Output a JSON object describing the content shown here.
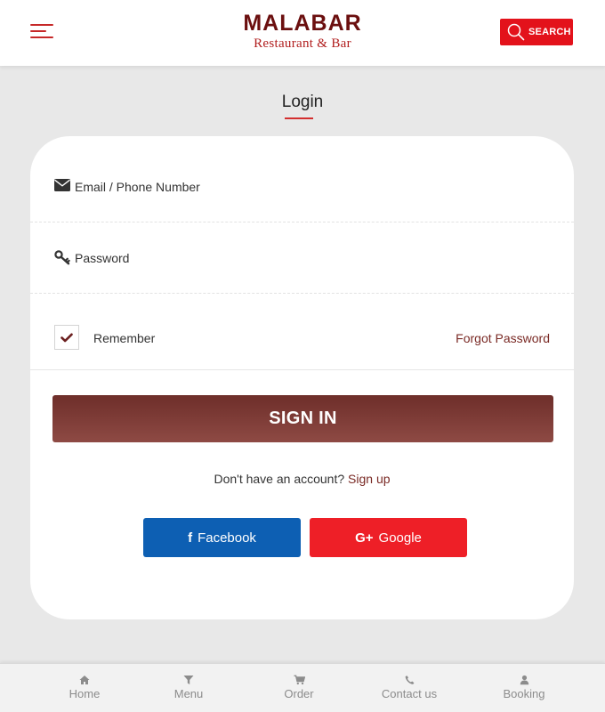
{
  "header": {
    "menu_icon": "hamburger-icon",
    "brand_name": "MALABAR",
    "brand_subtitle": "Restaurant & Bar",
    "search_icon": "search-icon",
    "search_label": "SEARCH"
  },
  "page": {
    "title": "Login"
  },
  "form": {
    "email_icon": "envelope-icon",
    "email_label": "Email / Phone Number",
    "password_icon": "key-icon",
    "password_label": "Password",
    "remember_checked": true,
    "remember_label": "Remember",
    "forgot_label": "Forgot Password",
    "signin_label": "SIGN IN",
    "signup_prompt": "Don't have an account?",
    "signup_link": "Sign up"
  },
  "social": {
    "facebook_icon": "f",
    "facebook_label": "Facebook",
    "google_icon": "G+",
    "google_label": "Google"
  },
  "bottom_nav": {
    "items": [
      {
        "label": "Home",
        "icon": "home-icon"
      },
      {
        "label": "Menu",
        "icon": "filter-icon"
      },
      {
        "label": "Order",
        "icon": "cart-icon"
      },
      {
        "label": "Contact us",
        "icon": "phone-icon"
      },
      {
        "label": "Booking",
        "icon": "user-icon"
      }
    ]
  },
  "colors": {
    "brand_dark": "#6b0f0f",
    "accent_red": "#e3121b",
    "signin_brown": "#7a3a35",
    "facebook_blue": "#0d5fb3",
    "google_red": "#ee1f27"
  }
}
